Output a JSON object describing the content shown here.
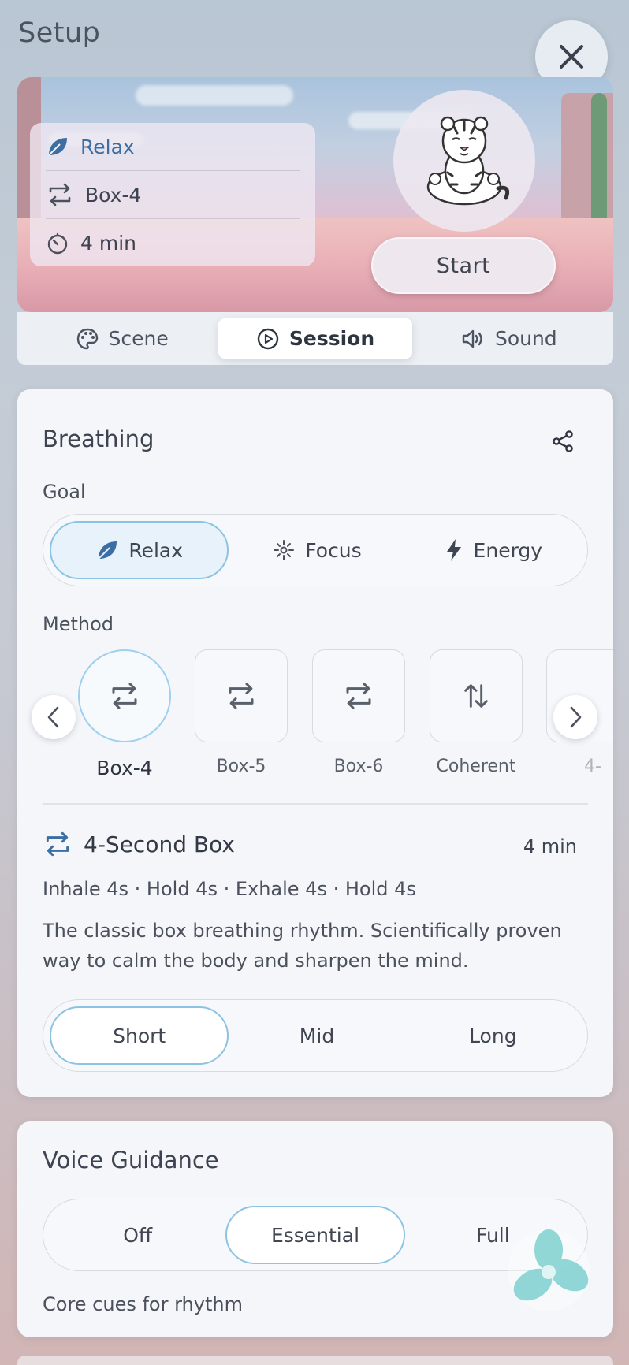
{
  "header": {
    "title": "Setup"
  },
  "summary": {
    "goal": "Relax",
    "method": "Box-4",
    "duration": "4 min"
  },
  "start_label": "Start",
  "tabs": [
    {
      "label": "Scene",
      "icon": "palette-icon"
    },
    {
      "label": "Session",
      "icon": "play-circle-icon",
      "active": true
    },
    {
      "label": "Sound",
      "icon": "speaker-icon"
    }
  ],
  "breathing": {
    "title": "Breathing",
    "goal_label": "Goal",
    "goals": [
      {
        "label": "Relax",
        "icon": "leaf-icon",
        "active": true
      },
      {
        "label": "Focus",
        "icon": "sparkle-icon"
      },
      {
        "label": "Energy",
        "icon": "bolt-icon"
      }
    ],
    "method_label": "Method",
    "methods": [
      {
        "label": "Box-4",
        "icon": "repeat-icon",
        "active": true
      },
      {
        "label": "Box-5",
        "icon": "repeat-icon"
      },
      {
        "label": "Box-6",
        "icon": "repeat-icon"
      },
      {
        "label": "Coherent",
        "icon": "up-down-arrows-icon"
      },
      {
        "label": "4-",
        "icon": "repeat-icon"
      }
    ],
    "detail": {
      "title": "4-Second Box",
      "duration": "4 min",
      "pattern": "Inhale 4s · Hold 4s · Exhale 4s · Hold 4s",
      "description": "The classic box breathing rhythm. Scientifically proven way to calm the body and sharpen the mind."
    },
    "lengths": [
      {
        "label": "Short",
        "active": true
      },
      {
        "label": "Mid"
      },
      {
        "label": "Long"
      }
    ]
  },
  "voice": {
    "title": "Voice Guidance",
    "options": [
      {
        "label": "Off"
      },
      {
        "label": "Essential",
        "active": true
      },
      {
        "label": "Full"
      }
    ],
    "hint": "Core cues for rhythm"
  },
  "colors": {
    "accent_blue": "#3d6ea3",
    "active_border": "#8dc3e2",
    "flower_teal": "#7fd1d0"
  }
}
